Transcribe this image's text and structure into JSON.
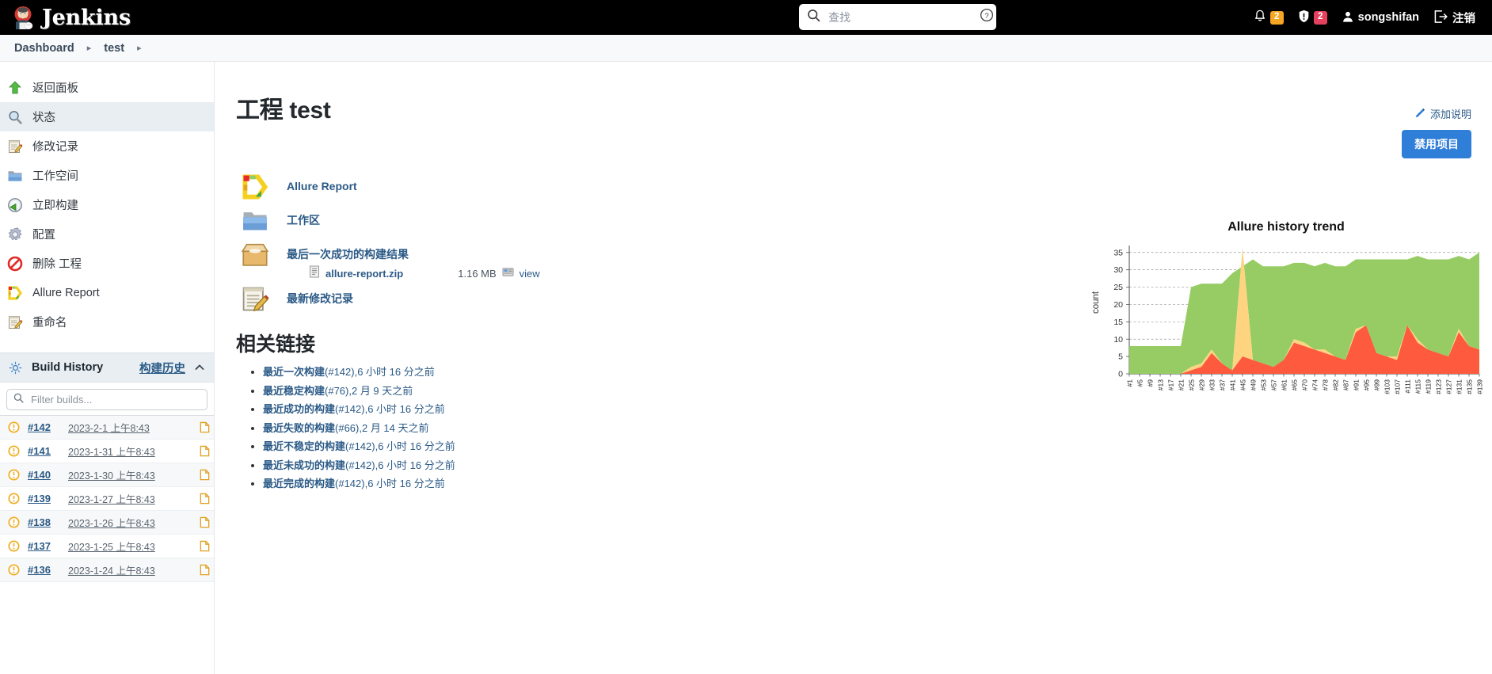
{
  "header": {
    "brand": "Jenkins",
    "search_placeholder": "查找",
    "search_value": "",
    "help_icon": "help-circle-icon",
    "notifications": {
      "icon": "bell-icon",
      "count": "2"
    },
    "security": {
      "icon": "shield-alert-icon",
      "count": "2"
    },
    "user": {
      "icon": "user-icon",
      "name": "songshifan"
    },
    "logout": {
      "icon": "logout-icon",
      "label": "注销"
    }
  },
  "breadcrumb": [
    {
      "label": "Dashboard"
    },
    {
      "label": "test"
    }
  ],
  "sidebar": {
    "items": [
      {
        "label": "返回面板",
        "icon": "up-arrow-icon",
        "active": false
      },
      {
        "label": "状态",
        "icon": "magnifier-icon",
        "active": true
      },
      {
        "label": "修改记录",
        "icon": "notepad-pencil-icon",
        "active": false
      },
      {
        "label": "工作空间",
        "icon": "folder-icon",
        "active": false
      },
      {
        "label": "立即构建",
        "icon": "build-now-icon",
        "active": false
      },
      {
        "label": "配置",
        "icon": "gear-icon",
        "active": false
      },
      {
        "label": "删除 工程",
        "icon": "delete-forbidden-icon",
        "active": false
      },
      {
        "label": "Allure Report",
        "icon": "allure-icon",
        "active": false
      },
      {
        "label": "重命名",
        "icon": "notepad-pencil-icon",
        "active": false
      }
    ],
    "build_history": {
      "icon": "history-sun-icon",
      "title": "Build History",
      "link_label": "构建历史",
      "collapse_icon": "chevron-up-icon",
      "filter_placeholder": "Filter builds...",
      "filter_value": "",
      "rows": [
        {
          "status": "unstable",
          "number": "#142",
          "date": "2023-2-1 上午8:43"
        },
        {
          "status": "unstable",
          "number": "#141",
          "date": "2023-1-31 上午8:43"
        },
        {
          "status": "unstable",
          "number": "#140",
          "date": "2023-1-30 上午8:43"
        },
        {
          "status": "unstable",
          "number": "#139",
          "date": "2023-1-27 上午8:43"
        },
        {
          "status": "unstable",
          "number": "#138",
          "date": "2023-1-26 上午8:43"
        },
        {
          "status": "unstable",
          "number": "#137",
          "date": "2023-1-25 上午8:43"
        },
        {
          "status": "unstable",
          "number": "#136",
          "date": "2023-1-24 上午8:43"
        }
      ]
    }
  },
  "main": {
    "page_title": "工程 test",
    "add_description": {
      "icon": "pencil-icon",
      "label": "添加说明"
    },
    "disable_button": "禁用项目",
    "links": [
      {
        "icon": "allure-icon",
        "label": "Allure Report"
      },
      {
        "icon": "folder-icon",
        "label": "工作区"
      },
      {
        "icon": "package-box-icon",
        "label": "最后一次成功的构建结果"
      },
      {
        "icon": "notepad-pencil-icon",
        "label": "最新修改记录"
      }
    ],
    "artifact": {
      "icon": "document-icon",
      "name": "allure-report.zip",
      "size": "1.16 MB",
      "view_icon": "view-icon",
      "view_label": "view"
    },
    "related_links_title": "相关链接",
    "related_links": [
      {
        "label": "最近一次构建",
        "detail": "(#142),6 小时 16 分之前"
      },
      {
        "label": "最近稳定构建",
        "detail": "(#76),2 月 9 天之前"
      },
      {
        "label": "最近成功的构建",
        "detail": "(#142),6 小时 16 分之前"
      },
      {
        "label": "最近失败的构建",
        "detail": "(#66),2 月 14 天之前"
      },
      {
        "label": "最近不稳定的构建",
        "detail": "(#142),6 小时 16 分之前"
      },
      {
        "label": "最近未成功的构建",
        "detail": "(#142),6 小时 16 分之前"
      },
      {
        "label": "最近完成的构建",
        "detail": "(#142),6 小时 16 分之前"
      }
    ]
  },
  "chart_data": {
    "type": "area",
    "title": "Allure history trend",
    "xlabel": "",
    "ylabel": "count",
    "ylim": [
      0,
      37
    ],
    "yticks": [
      0,
      5,
      10,
      15,
      20,
      25,
      30,
      35
    ],
    "grid": true,
    "legend_position": "none",
    "colors": {
      "passed": "#97cc64",
      "broken": "#ffd480",
      "failed": "#fd5a3e"
    },
    "x": [
      "#1",
      "#5",
      "#9",
      "#13",
      "#17",
      "#21",
      "#25",
      "#29",
      "#33",
      "#37",
      "#41",
      "#45",
      "#49",
      "#53",
      "#57",
      "#61",
      "#65",
      "#70",
      "#74",
      "#78",
      "#82",
      "#87",
      "#91",
      "#95",
      "#99",
      "#103",
      "#107",
      "#111",
      "#115",
      "#119",
      "#123",
      "#127",
      "#131",
      "#135",
      "#139"
    ],
    "xticks": [
      "#1",
      "#5",
      "#9",
      "#13",
      "#17",
      "#21",
      "#25",
      "#29",
      "#33",
      "#37",
      "#41",
      "#45",
      "#49",
      "#53",
      "#57",
      "#61",
      "#65",
      "#70",
      "#74",
      "#78",
      "#82",
      "#87",
      "#91",
      "#95",
      "#99",
      "#103",
      "#107",
      "#111",
      "#115",
      "#119",
      "#123",
      "#127",
      "#131",
      "#135",
      "#139"
    ],
    "series": [
      {
        "name": "failed",
        "values": [
          0,
          0,
          0,
          0,
          0,
          0,
          1,
          2,
          6,
          3,
          1,
          5,
          4,
          3,
          2,
          4,
          9,
          8,
          7,
          6,
          5,
          4,
          12,
          14,
          6,
          5,
          4,
          14,
          9,
          7,
          6,
          5,
          12,
          8,
          7
        ]
      },
      {
        "name": "broken",
        "values": [
          0,
          0,
          0,
          0,
          0,
          0,
          1,
          1,
          1,
          0,
          0,
          31,
          0,
          0,
          0,
          0,
          1,
          1,
          0,
          1,
          0,
          0,
          1,
          0,
          0,
          0,
          1,
          0,
          1,
          0,
          0,
          0,
          1,
          0,
          0
        ]
      },
      {
        "name": "passed",
        "values": [
          8,
          8,
          8,
          8,
          8,
          8,
          23,
          24,
          19,
          22,
          28,
          26,
          29,
          28,
          29,
          27,
          22,
          23,
          24,
          25,
          26,
          27,
          20,
          19,
          27,
          28,
          28,
          19,
          24,
          26,
          27,
          28,
          21,
          25,
          26
        ]
      }
    ],
    "total_top": [
      8,
      8,
      8,
      8,
      8,
      8,
      25,
      26,
      26,
      26,
      29,
      31,
      33,
      31,
      31,
      31,
      32,
      32,
      31,
      32,
      31,
      31,
      33,
      33,
      33,
      33,
      33,
      33,
      34,
      33,
      33,
      33,
      34,
      33,
      35
    ]
  }
}
